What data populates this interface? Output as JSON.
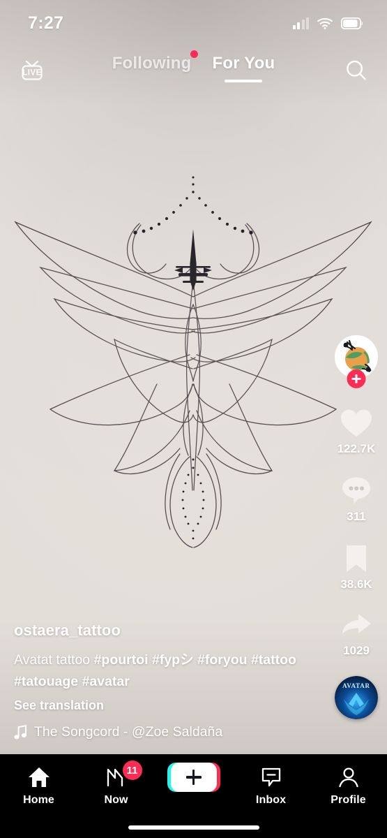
{
  "status_bar": {
    "time": "7:27",
    "signal_icon": "cellular-signal-icon",
    "signal_bars_filled": 2,
    "signal_bars_total": 4,
    "wifi_icon": "wifi-icon",
    "battery_icon": "battery-icon",
    "battery_level": 78
  },
  "top_nav": {
    "live_label": "LIVE",
    "live_icon": "live-tv-icon",
    "search_icon": "search-icon",
    "tabs": [
      {
        "label": "Following",
        "active": false,
        "has_dot": true
      },
      {
        "label": "For You",
        "active": true,
        "has_dot": false
      }
    ]
  },
  "action_rail": {
    "avatar_name": "avatar",
    "follow_label": "+",
    "like": {
      "icon": "heart-icon",
      "count": "122.7K"
    },
    "comment": {
      "icon": "comment-bubble-icon",
      "count": "311"
    },
    "bookmark": {
      "icon": "bookmark-icon",
      "count": "38.6K"
    },
    "share": {
      "icon": "share-arrow-icon",
      "count": "1029"
    },
    "album_label": "AVATAR"
  },
  "caption": {
    "username": "ostaera_tattoo",
    "description": "Avatat tattoo",
    "hashtags": [
      "#pourtoi",
      "#fypシ",
      "#foryou",
      "#tattoo",
      "#tatouage",
      "#avatar"
    ],
    "full_text": "Avatat tattoo #pourtoi #fypシ #foryou #tattoo #tatouage #avatar",
    "see_translation": "See translation",
    "music_icon": "music-note-icon",
    "music_text": "The Songcord - @Zoe Saldaña"
  },
  "bottom_nav": {
    "items": [
      {
        "label": "Home",
        "icon": "home-icon",
        "active": true,
        "badge": null
      },
      {
        "label": "Now",
        "icon": "now-icon",
        "active": false,
        "badge": "11"
      },
      {
        "label": "",
        "icon": "create-icon",
        "active": false,
        "badge": null
      },
      {
        "label": "Inbox",
        "icon": "inbox-icon",
        "active": false,
        "badge": null
      },
      {
        "label": "Profile",
        "icon": "profile-icon",
        "active": false,
        "badge": null
      }
    ]
  },
  "colors": {
    "accent_red": "#fe2c55",
    "accent_cyan": "#25f4ee",
    "nav_background": "#000000",
    "photo_background": "#e0dad6"
  }
}
